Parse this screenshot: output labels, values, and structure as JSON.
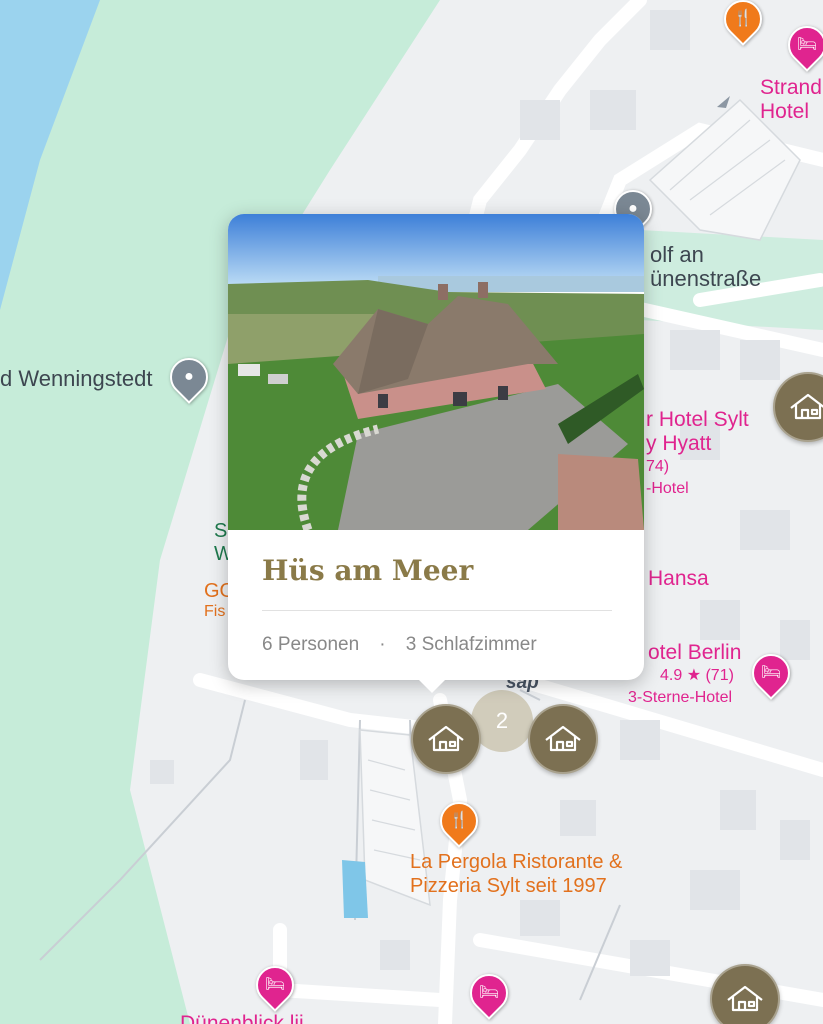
{
  "map": {
    "colors": {
      "water": "#9bd3ee",
      "beach_green": "#c6ecd9",
      "land": "#eef0f2",
      "road": "#ffffff",
      "house_marker": "#7c7052"
    },
    "places": [
      {
        "id": "wenningstedt",
        "label": "d Wenningstedt"
      },
      {
        "id": "golf",
        "label_line1": "olf an",
        "label_line2": "ünenstraße"
      }
    ],
    "hotels": [
      {
        "id": "strand",
        "line1": "Strand",
        "line2": "Hotel"
      },
      {
        "id": "hyatt",
        "line1": "r Hotel Sylt",
        "line2": "y Hyatt",
        "rating": "74)",
        "type": "-Hotel"
      },
      {
        "id": "hansa",
        "line1": "Hansa"
      },
      {
        "id": "berlin",
        "line1": "otel Berlin",
        "rating": "4.9 ★ (71)",
        "type": "3-Sterne-Hotel"
      },
      {
        "id": "duenenblick",
        "line1": "Dünenblick lii"
      }
    ],
    "restaurants": [
      {
        "id": "pergola",
        "line1": "La Pergola Ristorante &",
        "line2": "Pizzeria Sylt seit 1997"
      },
      {
        "id": "go",
        "line1": "GO",
        "line2": "Fis"
      }
    ],
    "green_labels": [
      {
        "line1": "S",
        "line2": "W"
      }
    ],
    "road_label": "sap",
    "cluster_count": "2",
    "icons": {
      "restaurant": "fork-knife-icon",
      "hotel": "bed-icon",
      "poi": "location-pin-icon",
      "holiday_home": "house-icon"
    }
  },
  "popup": {
    "title": "Hüs am Meer",
    "persons": "6 Personen",
    "separator": "·",
    "bedrooms": "3 Schlafzimmer",
    "image_alt": "Aerial photo of a thatched holiday house near the sea"
  }
}
